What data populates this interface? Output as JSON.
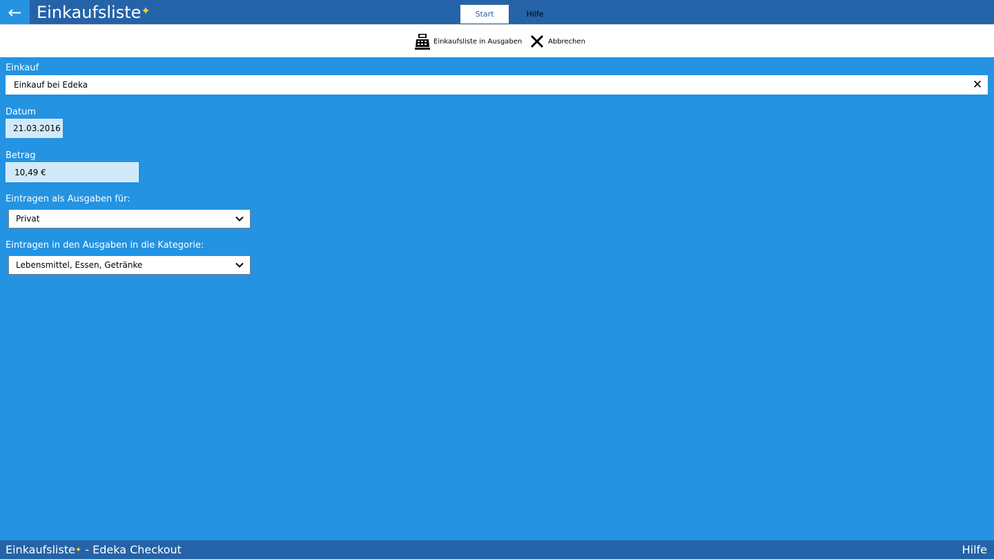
{
  "header": {
    "back_glyph": "←",
    "app_title": "Einkaufsliste",
    "sparkle_glyph": "✦",
    "tabs": [
      {
        "label": "Start",
        "active": true
      },
      {
        "label": "Hilfe",
        "active": false
      }
    ]
  },
  "toolbar": {
    "transfer_label": "Einkaufsliste in Ausgaben",
    "cancel_label": "Abbrechen"
  },
  "form": {
    "purchase": {
      "label": "Einkauf",
      "value": "Einkauf bei Edeka",
      "clear_glyph": "✕"
    },
    "date": {
      "label": "Datum",
      "value": "21.03.2016"
    },
    "amount": {
      "label": "Betrag",
      "value": "10,49 €"
    },
    "expense_for": {
      "label": "Eintragen als Ausgaben für:",
      "selected": "Privat"
    },
    "category": {
      "label": "Eintragen in den Ausgaben in die Kategorie:",
      "selected": "Lebensmittel, Essen, Getränke"
    }
  },
  "status": {
    "app_name": "Einkaufsliste",
    "context": " - Edeka Checkout",
    "help": "Hilfe"
  },
  "colors": {
    "background": "#2393e2",
    "bar": "#2563a8",
    "accent_star": "#f6d31e",
    "readonly_field": "#d2e9fa"
  }
}
